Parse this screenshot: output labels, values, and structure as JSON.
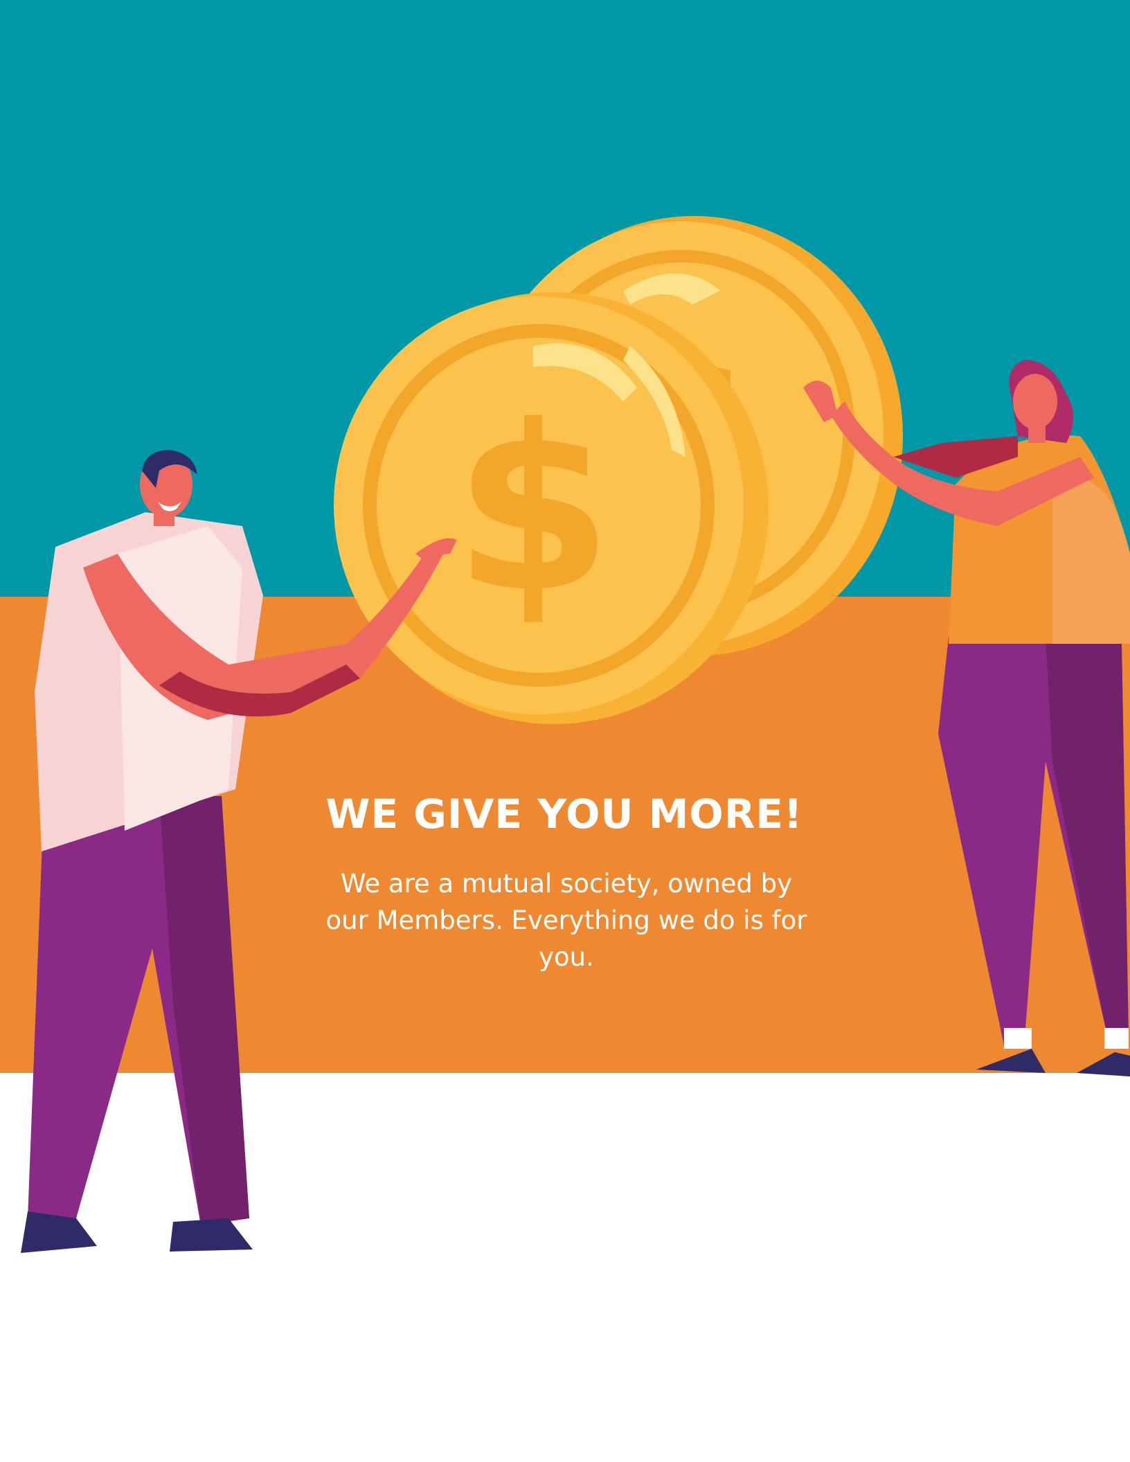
{
  "page": {
    "headline": "WE GIVE YOU MORE!",
    "body": "We are a mutual society, owned by our Members. Everything we do is for you."
  },
  "colors": {
    "teal": "#0098a6",
    "orange": "#ee8932",
    "white": "#ffffff",
    "coin_gold": "#fcc24e",
    "coin_rim": "#f2a72a",
    "pants_purple": "#8b2a86",
    "shirt_pink": "#f7d3d3",
    "skin": "#ee6a61",
    "shoes_navy": "#2f2a68"
  },
  "illustration": {
    "items": [
      "two-gold-coins",
      "man-holding-coin",
      "woman-holding-coin"
    ]
  }
}
